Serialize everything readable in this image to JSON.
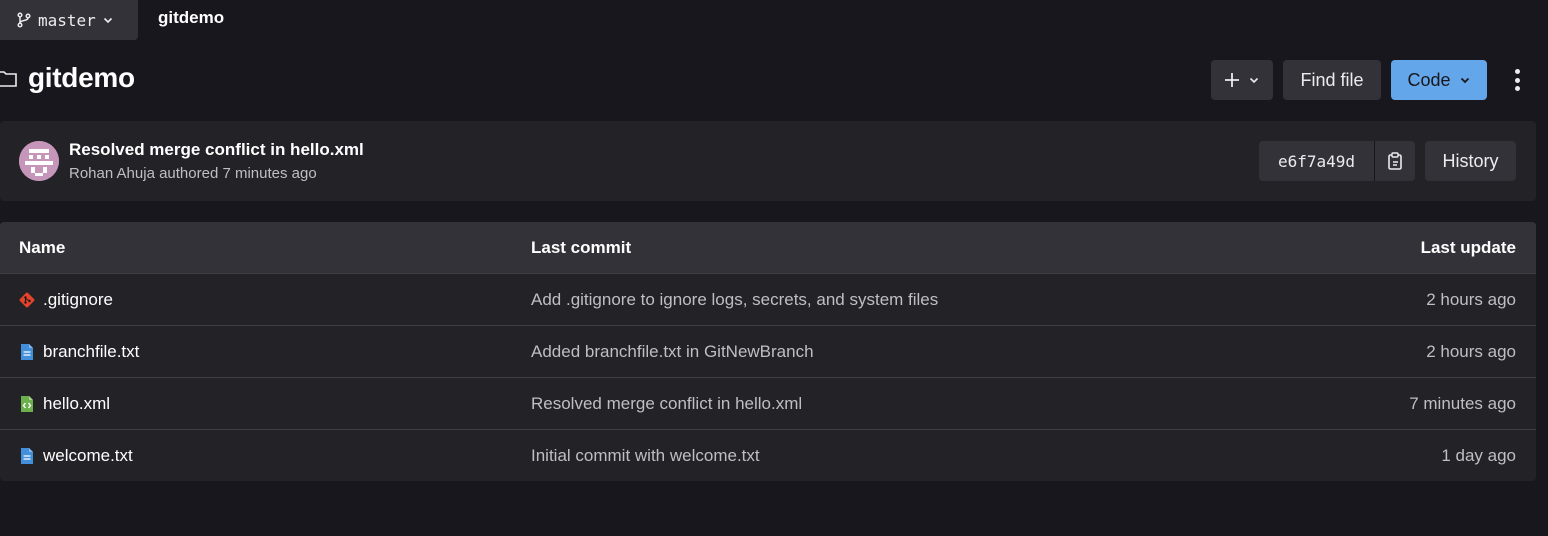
{
  "topbar": {
    "branch": "master",
    "breadcrumb": "gitdemo"
  },
  "header": {
    "title": "gitdemo",
    "find_file_label": "Find file",
    "code_label": "Code",
    "code_color": "#63a6e9"
  },
  "last_commit": {
    "title": "Resolved merge conflict in hello.xml",
    "author_line": "Rohan Ahuja authored 7 minutes ago",
    "sha": "e6f7a49d",
    "history_label": "History"
  },
  "table": {
    "headers": {
      "name": "Name",
      "last_commit": "Last commit",
      "last_update": "Last update"
    },
    "rows": [
      {
        "name": ".gitignore",
        "icon": "git-file-icon",
        "commit": "Add .gitignore to ignore logs, secrets, and system files",
        "updated": "2 hours ago"
      },
      {
        "name": "branchfile.txt",
        "icon": "text-file-icon",
        "commit": "Added branchfile.txt in GitNewBranch",
        "updated": "2 hours ago"
      },
      {
        "name": "hello.xml",
        "icon": "xml-file-icon",
        "commit": "Resolved merge conflict in hello.xml",
        "updated": "7 minutes ago"
      },
      {
        "name": "welcome.txt",
        "icon": "text-file-icon",
        "commit": "Initial commit with welcome.txt",
        "updated": "1 day ago"
      }
    ]
  }
}
